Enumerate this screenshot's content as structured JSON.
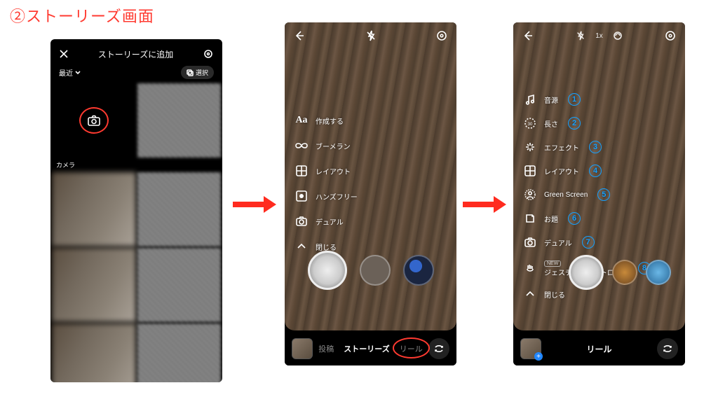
{
  "page_title": "②ストーリーズ画面",
  "phone1": {
    "header_title": "ストーリーズに追加",
    "recent_label": "最近",
    "select_label": "選択",
    "camera_label": "カメラ"
  },
  "phone2": {
    "tools": {
      "create": "作成する",
      "boomerang": "ブーメラン",
      "layout": "レイアウト",
      "handsfree": "ハンズフリー",
      "dual": "デュアル",
      "close": "閉じる"
    },
    "tabs": {
      "post": "投稿",
      "stories": "ストーリーズ",
      "reel": "リール"
    }
  },
  "phone3": {
    "zoom": "1x",
    "tools": {
      "audio": "音源",
      "length": "長さ",
      "effect": "エフェクト",
      "layout": "レイアウト",
      "greenscreen": "Green Screen",
      "topic": "お題",
      "dual": "デュアル",
      "gesture_new": "NEW",
      "gesture": "ジェスチャーコントロール",
      "close": "閉じる"
    },
    "numbers": {
      "n1": "1",
      "n2": "2",
      "n3": "3",
      "n4": "4",
      "n5": "5",
      "n6": "6",
      "n7": "7",
      "n8": "8"
    },
    "bottom_label": "リール"
  }
}
